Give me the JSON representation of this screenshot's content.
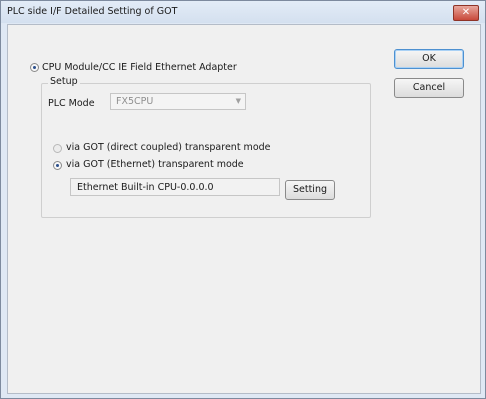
{
  "window": {
    "title": "PLC side I/F Detailed Setting of GOT",
    "close_label": "✕"
  },
  "buttons": {
    "ok": "OK",
    "cancel": "Cancel",
    "setting": "Setting"
  },
  "cpu_module": {
    "label": "CPU Module/CC IE Field Ethernet Adapter",
    "selected": true
  },
  "setup": {
    "title": "Setup",
    "plc_mode": {
      "label": "PLC Mode",
      "value": "FX5CPU",
      "enabled": false
    },
    "options": [
      {
        "label": "via GOT (direct coupled) transparent mode",
        "selected": false,
        "enabled": false
      },
      {
        "label": "via GOT (Ethernet) transparent mode",
        "selected": true,
        "enabled": true
      }
    ],
    "ethernet_target": "Ethernet Built-in CPU-0.0.0.0"
  }
}
